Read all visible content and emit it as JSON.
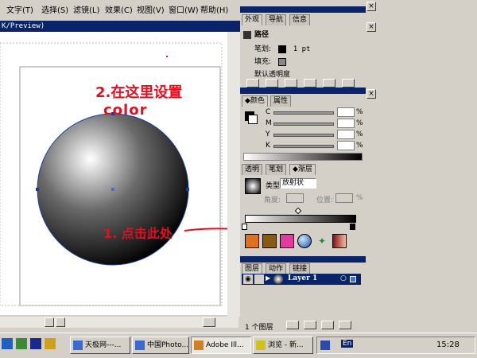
{
  "menu": {
    "items": [
      "文字(T)",
      "选择(S)",
      "滤镜(L)",
      "效果(C)",
      "视图(V)",
      "窗口(W)",
      "帮助(H)"
    ]
  },
  "document": {
    "title_fragment": "K/Preview)"
  },
  "annotations": {
    "top_note": "2.在这里设置",
    "top_note_word": "color",
    "bottom_note": "1. 点击此处"
  },
  "appearance_panel": {
    "tabs": [
      "外观",
      "导航",
      "信息"
    ],
    "header": "路径",
    "stroke_label": "笔划:",
    "stroke_value": "1 pt",
    "fill_label": "填充:",
    "default_transparency": "默认透明度"
  },
  "color_panel": {
    "tabs": [
      "颜色",
      "属性"
    ],
    "channels": [
      "C",
      "M",
      "Y",
      "K"
    ],
    "unit": "%"
  },
  "gradient_panel": {
    "tabs": [
      "透明",
      "笔划",
      "渐层"
    ],
    "type_label": "类型",
    "type_value": "放射状",
    "angle_label": "角度:",
    "position_label": "位置:",
    "unit": "%"
  },
  "layers_panel": {
    "tabs": [
      "图层",
      "动作",
      "链接"
    ],
    "layer_name": "Layer 1",
    "footer_count": "1 个图层"
  },
  "taskbar": {
    "buttons": [
      "天极网---...",
      "中国Photo...",
      "Adobe Ill...",
      "浏览 - 新..."
    ],
    "ime": "En",
    "clock": "15:28"
  },
  "colors": {
    "selection_blue": "#0a246a",
    "annotation_red": "#e01020",
    "path_blue": "#1a3ca0"
  }
}
